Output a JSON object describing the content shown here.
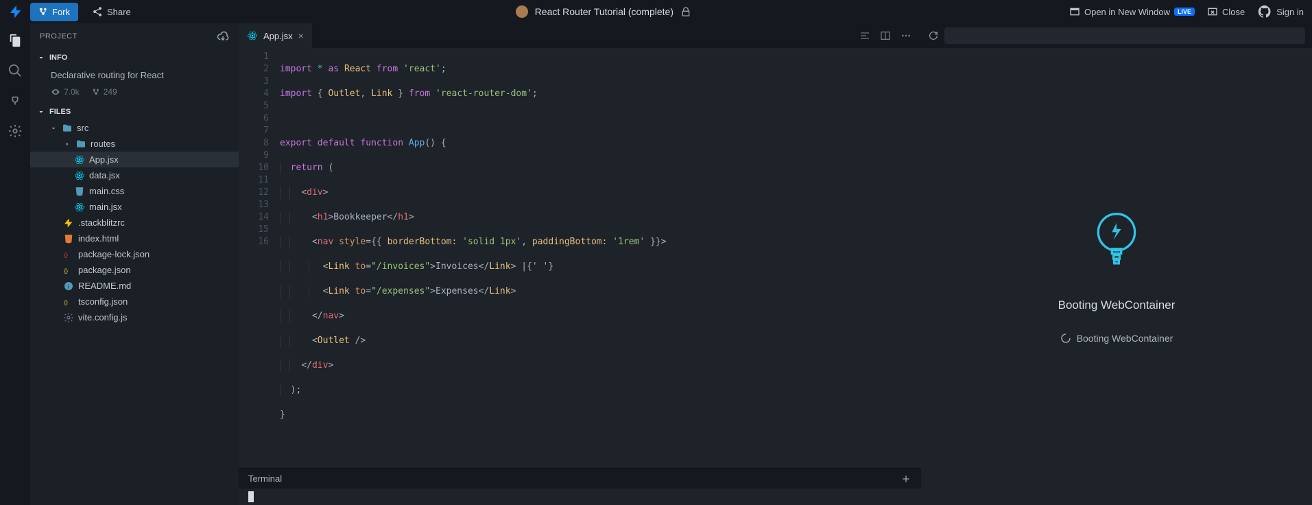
{
  "topbar": {
    "fork_label": "Fork",
    "share_label": "Share",
    "title": "React Router Tutorial (complete)",
    "open_new_window": "Open in New Window",
    "live_badge": "LIVE",
    "close_label": "Close",
    "signin_label": "Sign in"
  },
  "sidebar": {
    "project_label": "PROJECT",
    "info_label": "INFO",
    "info_desc": "Declarative routing for React",
    "views": "7.0k",
    "forks": "249",
    "files_label": "FILES",
    "tree": {
      "src": "src",
      "routes": "routes",
      "app_jsx": "App.jsx",
      "data_jsx": "data.jsx",
      "main_css": "main.css",
      "main_jsx": "main.jsx",
      "stackblitzrc": ".stackblitzrc",
      "index_html": "index.html",
      "pkg_lock": "package-lock.json",
      "pkg": "package.json",
      "readme": "README.md",
      "tsconfig": "tsconfig.json",
      "viteconfig": "vite.config.js"
    }
  },
  "editor": {
    "tab_label": "App.jsx",
    "code": {
      "l1_a": "import",
      "l1_b": "*",
      "l1_c": "as",
      "l1_d": "React",
      "l1_e": "from",
      "l1_f": "'react'",
      "l1_g": ";",
      "l2_a": "import",
      "l2_b": "{ ",
      "l2_c": "Outlet",
      "l2_d": ", ",
      "l2_e": "Link",
      "l2_f": " } ",
      "l2_g": "from",
      "l2_h": "'react-router-dom'",
      "l2_i": ";",
      "l4_a": "export",
      "l4_b": "default",
      "l4_c": "function",
      "l4_d": "App",
      "l4_e": "() {",
      "l5_a": "return",
      "l5_b": "(",
      "l6_a": "<",
      "l6_b": "div",
      "l6_c": ">",
      "l7_a": "<",
      "l7_b": "h1",
      "l7_c": ">",
      "l7_d": "Bookkeeper",
      "l7_e": "</",
      "l7_f": "h1",
      "l7_g": ">",
      "l8_a": "<",
      "l8_b": "nav",
      "l8_c": " style",
      "l8_d": "=",
      "l8_e": "{{ ",
      "l8_f": "borderBottom:",
      "l8_g": " 'solid 1px'",
      "l8_h": ", ",
      "l8_i": "paddingBottom:",
      "l8_j": " '1rem'",
      "l8_k": " }}",
      "l8_l": ">",
      "l9_a": "<",
      "l9_b": "Link",
      "l9_c": " to",
      "l9_d": "=",
      "l9_e": "\"/invoices\"",
      "l9_f": ">",
      "l9_g": "Invoices",
      "l9_h": "</",
      "l9_i": "Link",
      "l9_j": ">",
      "l9_k": " |",
      "l9_l": "{' '}",
      "l10_a": "<",
      "l10_b": "Link",
      "l10_c": " to",
      "l10_d": "=",
      "l10_e": "\"/expenses\"",
      "l10_f": ">",
      "l10_g": "Expenses",
      "l10_h": "</",
      "l10_i": "Link",
      "l10_j": ">",
      "l11_a": "</",
      "l11_b": "nav",
      "l11_c": ">",
      "l12_a": "<",
      "l12_b": "Outlet",
      "l12_c": " />",
      "l13_a": "</",
      "l13_b": "div",
      "l13_c": ">",
      "l14": ");",
      "l15": "}"
    }
  },
  "terminal": {
    "label": "Terminal"
  },
  "preview": {
    "title": "Booting WebContainer",
    "sub": "Booting WebContainer"
  }
}
